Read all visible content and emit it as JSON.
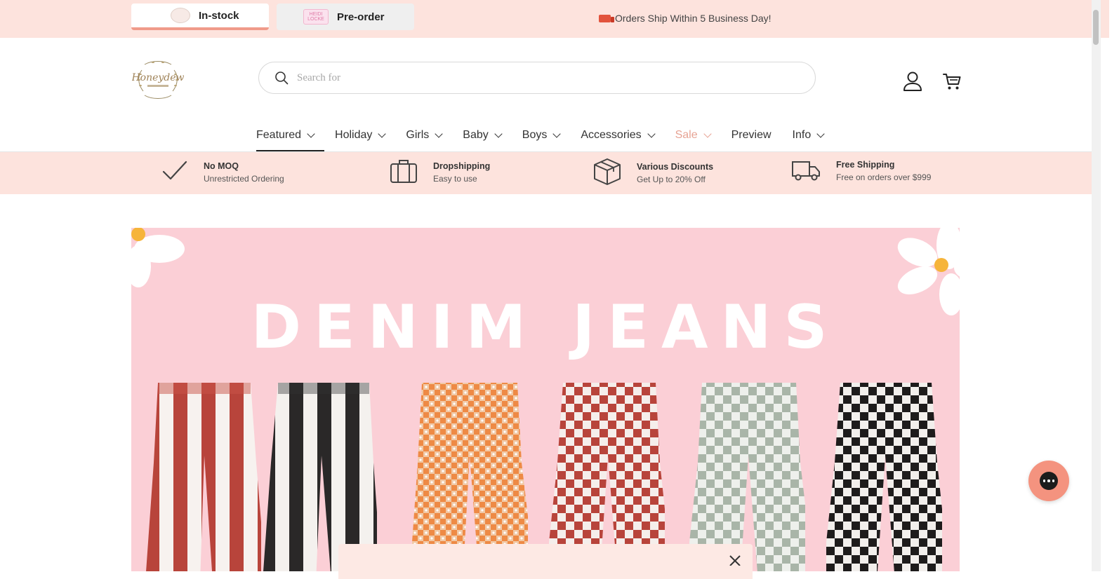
{
  "topbar": {
    "tabs": [
      {
        "label": "In-stock",
        "active": true
      },
      {
        "label": "Pre-order",
        "active": false,
        "logo_text": "HEIDI LOCKE"
      }
    ],
    "shipping_message": "Orders Ship Within 5 Business Day!"
  },
  "header": {
    "logo_text": "Honeydew",
    "search_placeholder": "Search for"
  },
  "nav": {
    "items": [
      {
        "label": "Featured",
        "dropdown": true,
        "active": true
      },
      {
        "label": "Holiday",
        "dropdown": true
      },
      {
        "label": "Girls",
        "dropdown": true
      },
      {
        "label": "Baby",
        "dropdown": true
      },
      {
        "label": "Boys",
        "dropdown": true
      },
      {
        "label": "Accessories",
        "dropdown": true
      },
      {
        "label": "Sale",
        "dropdown": true
      },
      {
        "label": "Preview",
        "dropdown": false
      },
      {
        "label": "Info",
        "dropdown": true
      }
    ]
  },
  "features": [
    {
      "icon": "checkmark-icon",
      "title": "No MOQ",
      "subtitle": "Unrestricted Ordering"
    },
    {
      "icon": "briefcase-icon",
      "title": "Dropshipping",
      "subtitle": "Easy to use"
    },
    {
      "icon": "box-icon",
      "title": "Various Discounts",
      "subtitle": "Get Up to 20% Off"
    },
    {
      "icon": "truck-icon",
      "title": "Free Shipping",
      "subtitle": "Free on orders over $999"
    }
  ],
  "banner": {
    "title": "DENIM JEANS",
    "pants": [
      "red-white-stripe",
      "black-white-stripe",
      "orange-floral-check",
      "red-check",
      "sage-check",
      "black-check"
    ]
  },
  "colors": {
    "accent_pink": "#fde3dd",
    "banner_pink": "#fbcfd6",
    "sale": "#e7a394",
    "chat": "#f4937f"
  }
}
